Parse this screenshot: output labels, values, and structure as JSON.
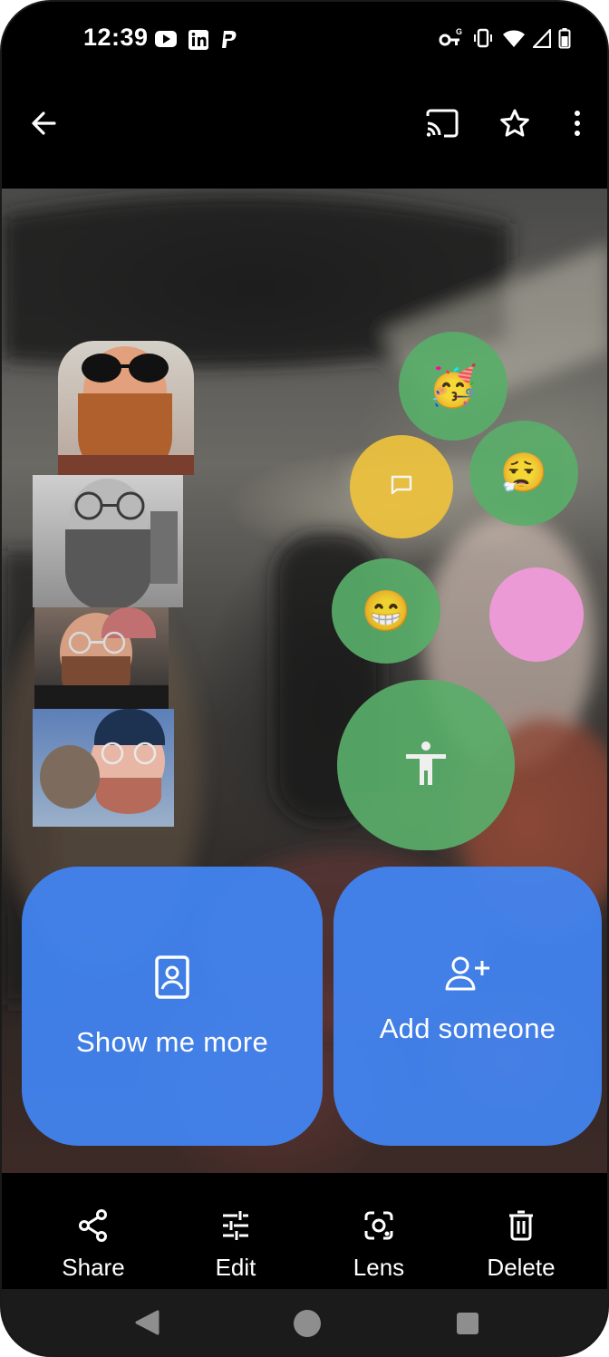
{
  "status_bar": {
    "time": "12:39",
    "notification_icons": [
      "youtube-icon",
      "linkedin-icon",
      "paypal-icon"
    ],
    "system_icons": [
      "vpn-key-icon",
      "vibrate-icon",
      "wifi-icon",
      "signal-icon",
      "battery-icon"
    ]
  },
  "app_bar": {
    "back_icon": "arrow-left-icon",
    "actions": [
      "cast-icon",
      "star-outline-icon",
      "more-vert-icon"
    ]
  },
  "accessibility_overlay": {
    "emoji_party": "🥳",
    "emoji_exhale": "😮‍💨",
    "emoji_grin": "😁",
    "chat_icon": "chat-bubble-icon",
    "accessibility_icon": "accessibility-person-icon",
    "colors": {
      "green": "#5aae6a",
      "yellow": "#eec33d",
      "pink": "#f19adc",
      "blue": "#4285f4"
    }
  },
  "main_actions": {
    "show_more_label": "Show me more",
    "add_someone_label": "Add someone"
  },
  "bottom_actions": [
    {
      "label": "Share",
      "icon": "share-icon"
    },
    {
      "label": "Edit",
      "icon": "tune-icon"
    },
    {
      "label": "Lens",
      "icon": "lens-icon"
    },
    {
      "label": "Delete",
      "icon": "trash-icon"
    }
  ],
  "nav_bar": [
    "back-triangle-icon",
    "home-circle-icon",
    "recents-square-icon"
  ]
}
